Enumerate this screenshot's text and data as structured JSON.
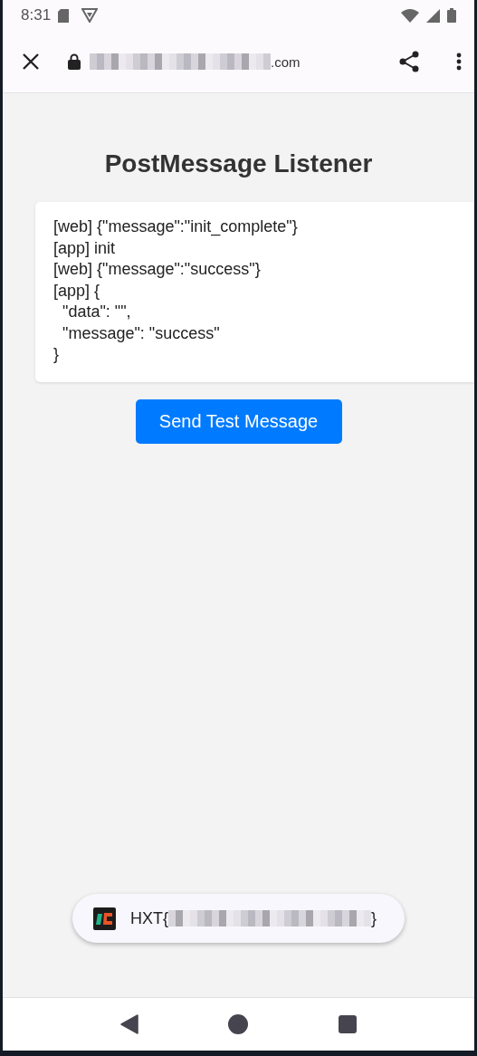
{
  "status_bar": {
    "time": "8:31"
  },
  "browser_toolbar": {
    "url_suffix": ".com",
    "url_redacted": true
  },
  "page": {
    "title": "PostMessage Listener",
    "log_lines": [
      "[web] {\"message\":\"init_complete\"}",
      "[app] init",
      "[web] {\"message\":\"success\"}",
      "[app] {",
      "  \"data\": \"\",",
      "  \"message\": \"success\"",
      "}"
    ],
    "button": "Send Test Message"
  },
  "toast": {
    "prefix": "HXT{",
    "suffix": "}",
    "redacted": true
  }
}
